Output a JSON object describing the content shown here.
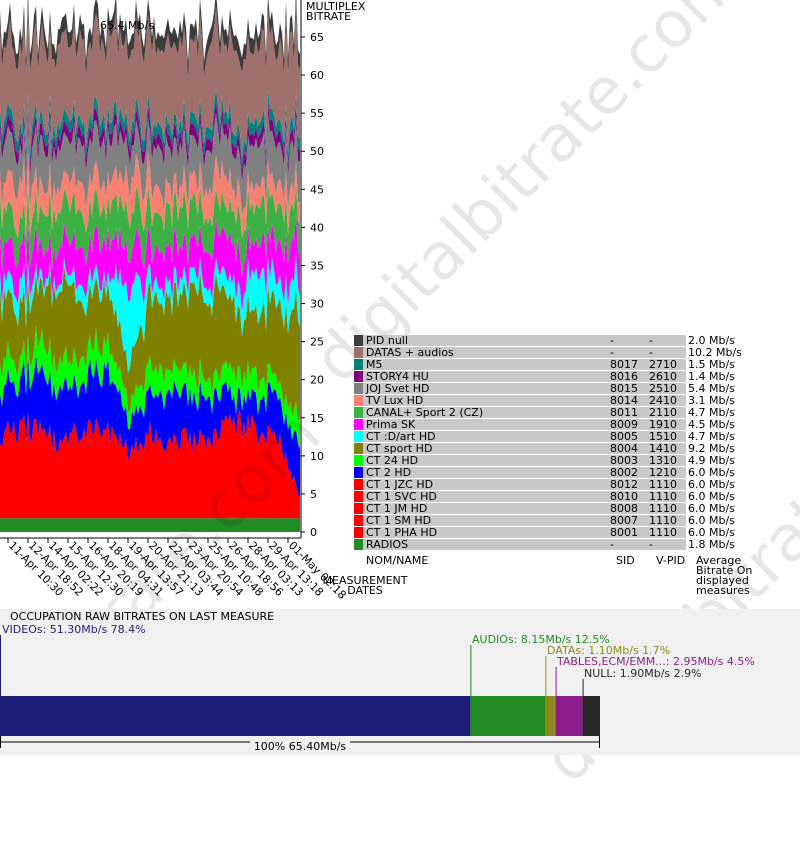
{
  "chart_data": {
    "type": "area",
    "title": "65.4 Mb/s",
    "ylabel": "MULTIPLEX BITRATE",
    "xlabel": "MEASUREMENT DATES",
    "ylim": [
      0,
      65
    ],
    "yticks": [
      0,
      5,
      10,
      15,
      20,
      25,
      30,
      35,
      40,
      45,
      50,
      55,
      60,
      65
    ],
    "xticks": [
      "11-Apr 10:30",
      "12-Apr 18:52",
      "14-Apr 02:22",
      "15-Apr 12:30",
      "16-Apr 20:19",
      "18-Apr 04:31",
      "19-Apr 13:57",
      "20-Apr 21:13",
      "22-Apr 03:44",
      "23-Apr 20:54",
      "25-Apr 10:48",
      "26-Apr 18:56",
      "28-Apr 03:13",
      "29-Apr 13:18",
      "01-May 02:18"
    ],
    "series": [
      {
        "name": "RADIOS",
        "color": "#228b22",
        "values": [
          1.8,
          1.8,
          1.8,
          1.8,
          1.8,
          1.8,
          1.8,
          1.8,
          1.8,
          1.8,
          1.8,
          1.8,
          1.8,
          1.8,
          1.8
        ]
      },
      {
        "name": "CT 1 PHA HD",
        "color": "#ff0000",
        "values": [
          10.5,
          12.5,
          11.0,
          9.5,
          12.5,
          11.0,
          9.0,
          11.0,
          10.5,
          10.0,
          10.5,
          12.5,
          11.5,
          10.0,
          3.0
        ]
      },
      {
        "name": "CT 2 HD",
        "color": "#0000ff",
        "values": [
          6.5,
          6.0,
          8.0,
          6.5,
          6.5,
          8.0,
          4.0,
          5.5,
          6.5,
          5.5,
          5.5,
          3.0,
          4.5,
          5.5,
          6.5
        ]
      },
      {
        "name": "CT 24 HD",
        "color": "#00ff00",
        "values": [
          3.5,
          2.5,
          4.0,
          3.5,
          3.5,
          3.5,
          2.5,
          3.5,
          3.0,
          3.0,
          2.5,
          3.5,
          3.0,
          2.0,
          3.5
        ]
      },
      {
        "name": "CT sport HD",
        "color": "#808000",
        "values": [
          8.7,
          7.2,
          7.2,
          10.7,
          6.7,
          7.7,
          4.7,
          9.2,
          9.2,
          10.7,
          10.7,
          8.2,
          7.7,
          10.7,
          13.7
        ]
      },
      {
        "name": "CT :D/art HD",
        "color": "#00ffff",
        "values": [
          2.0,
          3.0,
          1.0,
          1.0,
          2.5,
          1.0,
          11.0,
          2.0,
          2.0,
          2.0,
          2.0,
          3.0,
          5.5,
          3.0,
          4.5
        ]
      },
      {
        "name": "Prima SK",
        "color": "#ff00ff",
        "values": [
          4.5,
          4.5,
          4.0,
          4.5,
          4.5,
          5.0,
          5.0,
          4.5,
          4.5,
          4.0,
          4.5,
          5.0,
          4.0,
          5.0,
          4.5
        ]
      },
      {
        "name": "CANAL+ Sport 2 (CZ)",
        "color": "#3cb043",
        "values": [
          5.0,
          4.0,
          5.0,
          5.0,
          4.5,
          4.5,
          5.0,
          4.5,
          5.0,
          5.0,
          4.0,
          4.5,
          5.0,
          5.0,
          4.0
        ]
      },
      {
        "name": "TV Lux HD",
        "color": "#fa8072",
        "values": [
          3.0,
          5.0,
          3.0,
          3.0,
          4.0,
          3.0,
          4.0,
          4.0,
          2.5,
          3.0,
          4.0,
          3.0,
          2.5,
          3.0,
          3.0
        ]
      },
      {
        "name": "JOJ Svet HD",
        "color": "#808080",
        "values": [
          5.5,
          4.5,
          5.5,
          5.0,
          5.0,
          5.5,
          4.5,
          5.0,
          5.5,
          5.0,
          5.5,
          5.0,
          5.5,
          5.0,
          5.0
        ]
      },
      {
        "name": "STORY4 HU",
        "color": "#800080",
        "values": [
          1.5,
          1.5,
          1.5,
          1.5,
          1.5,
          1.5,
          1.5,
          1.5,
          1.5,
          1.5,
          1.5,
          1.5,
          1.5,
          1.5,
          1.5
        ]
      },
      {
        "name": "M5",
        "color": "#008080",
        "values": [
          1.5,
          1.5,
          1.5,
          1.5,
          1.5,
          1.5,
          1.5,
          1.5,
          1.5,
          1.5,
          1.5,
          1.5,
          1.5,
          1.5,
          1.5
        ]
      },
      {
        "name": "DATAS + audios",
        "color": "#a0706c",
        "values": [
          10.2,
          10.2,
          10.2,
          10.2,
          10.2,
          10.2,
          10.2,
          10.2,
          10.2,
          10.2,
          10.2,
          10.2,
          10.2,
          10.2,
          10.2
        ]
      },
      {
        "name": "PID null",
        "color": "#3c3c3c",
        "values": [
          2.0,
          2.0,
          2.0,
          2.0,
          2.0,
          2.0,
          2.0,
          2.0,
          2.0,
          2.0,
          2.0,
          2.0,
          2.0,
          2.0,
          2.0
        ]
      }
    ]
  },
  "legend": {
    "headers": {
      "name": "NOM/NAME",
      "sid": "SID",
      "vpid": "V-PID",
      "bitrate": "Average Bitrate On displayed measures"
    },
    "rows": [
      {
        "name": "PID null",
        "sid": "-",
        "vpid": "-",
        "bitrate": "2.0 Mb/s",
        "color": "#3c3c3c"
      },
      {
        "name": "DATAS + audios",
        "sid": "-",
        "vpid": "-",
        "bitrate": "10.2 Mb/s",
        "color": "#a0706c"
      },
      {
        "name": "M5",
        "sid": "8017",
        "vpid": "2710",
        "bitrate": "1.5 Mb/s",
        "color": "#008080"
      },
      {
        "name": "STORY4 HU",
        "sid": "8016",
        "vpid": "2610",
        "bitrate": "1.4 Mb/s",
        "color": "#800080"
      },
      {
        "name": "JOJ Svet HD",
        "sid": "8015",
        "vpid": "2510",
        "bitrate": "5.4 Mb/s",
        "color": "#808080"
      },
      {
        "name": "TV Lux HD",
        "sid": "8014",
        "vpid": "2410",
        "bitrate": "3.1 Mb/s",
        "color": "#fa8072"
      },
      {
        "name": "CANAL+ Sport 2 (CZ)",
        "sid": "8011",
        "vpid": "2110",
        "bitrate": "4.7 Mb/s",
        "color": "#3cb043"
      },
      {
        "name": "Prima SK",
        "sid": "8009",
        "vpid": "1910",
        "bitrate": "4.5 Mb/s",
        "color": "#ff00ff"
      },
      {
        "name": "CT :D/art HD",
        "sid": "8005",
        "vpid": "1510",
        "bitrate": "4.7 Mb/s",
        "color": "#00ffff"
      },
      {
        "name": "CT sport HD",
        "sid": "8004",
        "vpid": "1410",
        "bitrate": "9.2 Mb/s",
        "color": "#808000"
      },
      {
        "name": "CT 24 HD",
        "sid": "8003",
        "vpid": "1310",
        "bitrate": "4.9 Mb/s",
        "color": "#00ff00"
      },
      {
        "name": "CT 2 HD",
        "sid": "8002",
        "vpid": "1210",
        "bitrate": "6.0 Mb/s",
        "color": "#0000ff"
      },
      {
        "name": "CT 1 JZC HD",
        "sid": "8012",
        "vpid": "1110",
        "bitrate": "6.0 Mb/s",
        "color": "#ff0000"
      },
      {
        "name": "CT 1 SVC HD",
        "sid": "8010",
        "vpid": "1110",
        "bitrate": "6.0 Mb/s",
        "color": "#ff0000"
      },
      {
        "name": "CT 1 JM HD",
        "sid": "8008",
        "vpid": "1110",
        "bitrate": "6.0 Mb/s",
        "color": "#ff0000"
      },
      {
        "name": "CT 1 SM HD",
        "sid": "8007",
        "vpid": "1110",
        "bitrate": "6.0 Mb/s",
        "color": "#ff0000"
      },
      {
        "name": "CT 1 PHA HD",
        "sid": "8001",
        "vpid": "1110",
        "bitrate": "6.0 Mb/s",
        "color": "#ff0000"
      },
      {
        "name": "RADIOS",
        "sid": "-",
        "vpid": "-",
        "bitrate": "1.8 Mb/s",
        "color": "#228b22"
      }
    ]
  },
  "occupation": {
    "title": "OCCUPATION RAW BITRATES ON LAST MEASURE",
    "total": "100%  65.40Mb/s",
    "segments": [
      {
        "label": "VIDEOs: 51.30Mb/s  78.4%",
        "share": 0.784,
        "color": "#1e1e78"
      },
      {
        "label": "AUDIOs: 8.15Mb/s  12.5%",
        "share": 0.125,
        "color": "#228b22"
      },
      {
        "label": "DATAs: 1.10Mb/s  1.7%",
        "share": 0.017,
        "color": "#8b8b1e"
      },
      {
        "label": "TABLES,ECM/EMM...: 2.95Mb/s  4.5%",
        "share": 0.045,
        "color": "#8b1e8b"
      },
      {
        "label": "NULL: 1.90Mb/s  2.9%",
        "share": 0.029,
        "color": "#282828"
      }
    ]
  },
  "watermark": "digitalbitrate.com"
}
